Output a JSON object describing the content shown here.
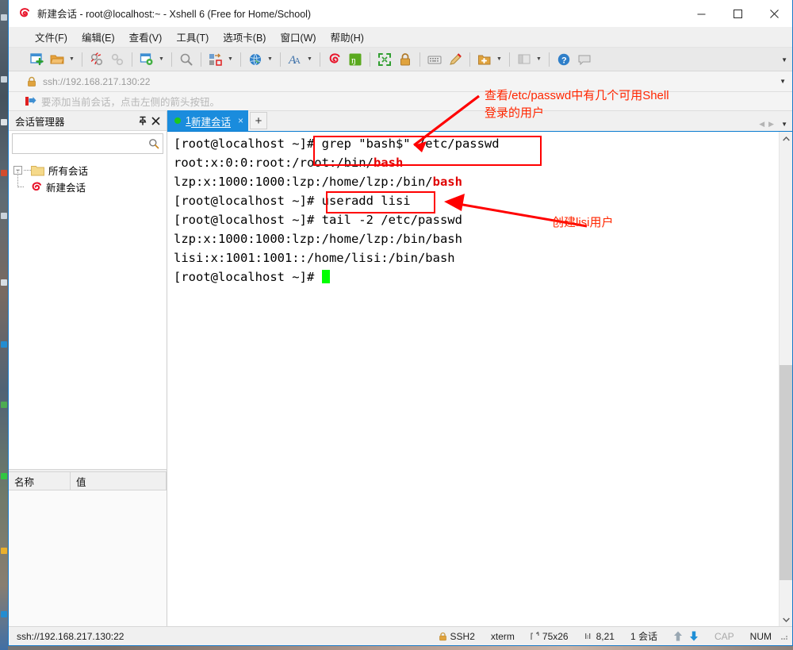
{
  "window": {
    "title": "新建会话 - root@localhost:~ - Xshell 6 (Free for Home/School)",
    "icon": "xshell-logo-icon",
    "minimize": "—",
    "maximize": "□",
    "close": "✕"
  },
  "menubar": {
    "items": [
      {
        "label": "文件(F)",
        "name": "menu-file"
      },
      {
        "label": "编辑(E)",
        "name": "menu-edit"
      },
      {
        "label": "查看(V)",
        "name": "menu-view"
      },
      {
        "label": "工具(T)",
        "name": "menu-tools"
      },
      {
        "label": "选项卡(B)",
        "name": "menu-tab"
      },
      {
        "label": "窗口(W)",
        "name": "menu-window"
      },
      {
        "label": "帮助(H)",
        "name": "menu-help"
      }
    ]
  },
  "toolbar": {
    "overflow_caret": "▼",
    "buttons": [
      "new-session-icon",
      "open-folder-icon",
      "disconnect-icon",
      "reconnect-icon",
      "session-properties-icon",
      "find-icon",
      "transfer-file-icon",
      "globe-icon",
      "font-icon",
      "xshell-icon",
      "xftp-icon",
      "fullscreen-icon",
      "lock-icon",
      "keyboard-icon",
      "highlight-icon",
      "new-folder-icon",
      "layout-icon",
      "help-icon",
      "feedback-icon"
    ]
  },
  "addressbar": {
    "lock_icon": "lock-icon",
    "value": "ssh://192.168.217.130:22",
    "caret": "▼"
  },
  "hintbar": {
    "icon": "red-arrow-icon",
    "text": "要添加当前会话，点击左侧的箭头按钮。"
  },
  "sidebar": {
    "title": "会话管理器",
    "pin_icon": "pin-icon",
    "close_icon": "close-icon",
    "search": {
      "value": "",
      "placeholder": "",
      "icon": "search-icon"
    },
    "tree": {
      "root": {
        "label": "所有会话",
        "toggle": "−",
        "icon": "folder-icon"
      },
      "children": [
        {
          "label": "新建会话",
          "icon": "xshell-session-icon"
        }
      ]
    },
    "properties": {
      "columns": [
        "名称",
        "值"
      ],
      "rows": []
    }
  },
  "tabs": {
    "items": [
      {
        "index": "1",
        "label": "新建会话",
        "status_dot": "#1ec81e",
        "close": "×"
      }
    ],
    "add_label": "+",
    "nav_prev": "◀",
    "nav_next": "▶",
    "nav_menu": "▼"
  },
  "terminal": {
    "lines": [
      [
        {
          "t": "[root@localhost ~]# grep \"bash$\" /etc/passwd",
          "c": "normal"
        }
      ],
      [
        {
          "t": "root:x:0:0:root:/root:/bin/",
          "c": "normal"
        },
        {
          "t": "bash",
          "c": "red"
        }
      ],
      [
        {
          "t": "lzp:x:1000:1000:lzp:/home/lzp:/bin/",
          "c": "normal"
        },
        {
          "t": "bash",
          "c": "red"
        }
      ],
      [
        {
          "t": "[root@localhost ~]# useradd lisi",
          "c": "normal"
        }
      ],
      [
        {
          "t": "[root@localhost ~]# tail -2 /etc/passwd",
          "c": "normal"
        }
      ],
      [
        {
          "t": "lzp:x:1000:1000:lzp:/home/lzp:/bin/bash",
          "c": "normal"
        }
      ],
      [
        {
          "t": "lisi:x:1001:1001::/home/lisi:/bin/bash",
          "c": "normal"
        }
      ],
      [
        {
          "t": "[root@localhost ~]# ",
          "c": "normal"
        },
        {
          "t": "",
          "c": "cursor"
        }
      ]
    ],
    "cursor_color": "#00ff00",
    "highlight_color": "#ff0000"
  },
  "annotations": [
    {
      "name": "annotation-grep-note",
      "text": "查看/etc/passwd中有几个可用Shell\n登录的用户",
      "color": "#ff2600"
    },
    {
      "name": "annotation-useradd-note",
      "text": "创建lisi用户",
      "color": "#ff2600"
    }
  ],
  "statusbar": {
    "url": "ssh://192.168.217.130:22",
    "protocol": "SSH2",
    "protocol_icon": "lock-icon",
    "terminal_type": "xterm",
    "size_icon": "resize-icon",
    "size": "75x26",
    "pos_icon": "cursor-icon",
    "position": "8,21",
    "sessions": "1 会话",
    "upload_icon": "arrow-up-icon",
    "download_icon": "arrow-down-icon",
    "cap": "CAP",
    "num": "NUM"
  }
}
